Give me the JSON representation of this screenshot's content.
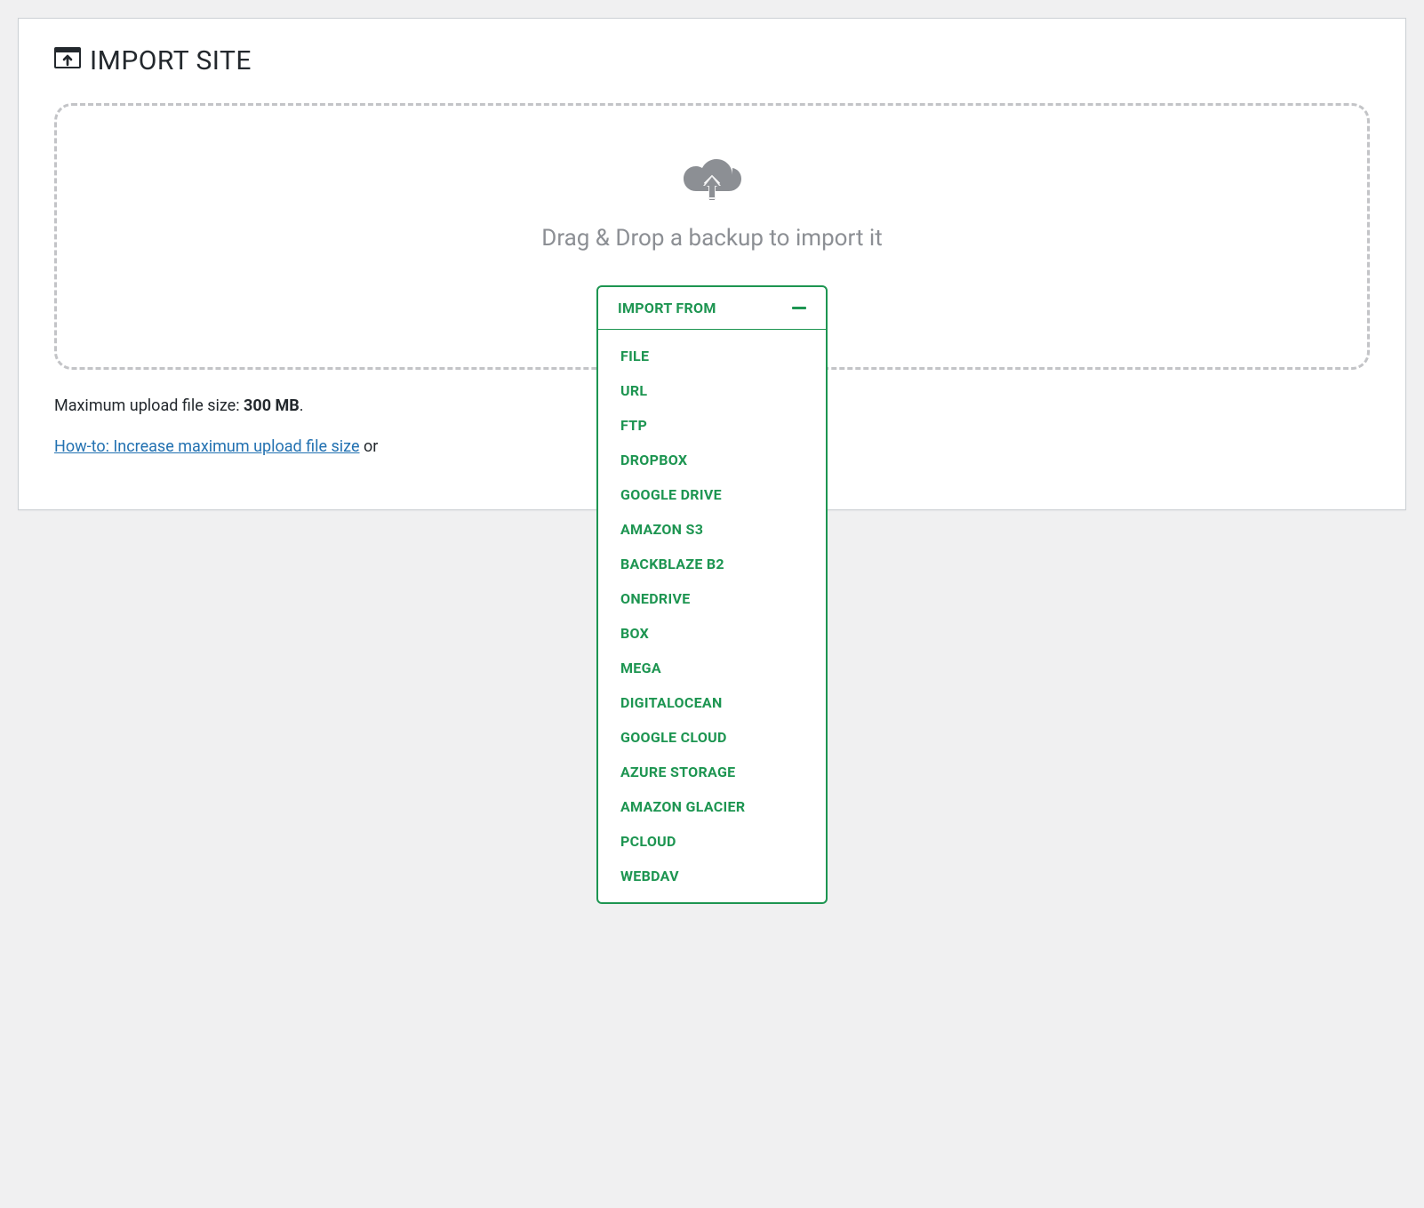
{
  "panel": {
    "title": "IMPORT SITE"
  },
  "dropzone": {
    "text": "Drag & Drop a backup to import it"
  },
  "importFrom": {
    "label": "IMPORT FROM",
    "options": [
      "FILE",
      "URL",
      "FTP",
      "DROPBOX",
      "GOOGLE DRIVE",
      "AMAZON S3",
      "BACKBLAZE B2",
      "ONEDRIVE",
      "BOX",
      "MEGA",
      "DIGITALOCEAN",
      "GOOGLE CLOUD",
      "AZURE STORAGE",
      "AMAZON GLACIER",
      "PCLOUD",
      "WEBDAV"
    ]
  },
  "upload": {
    "sizeLabel": "Maximum upload file size: ",
    "sizeValue": "300 MB",
    "period": "."
  },
  "help": {
    "linkText": "How-to: Increase maximum upload file size",
    "or": " or "
  }
}
